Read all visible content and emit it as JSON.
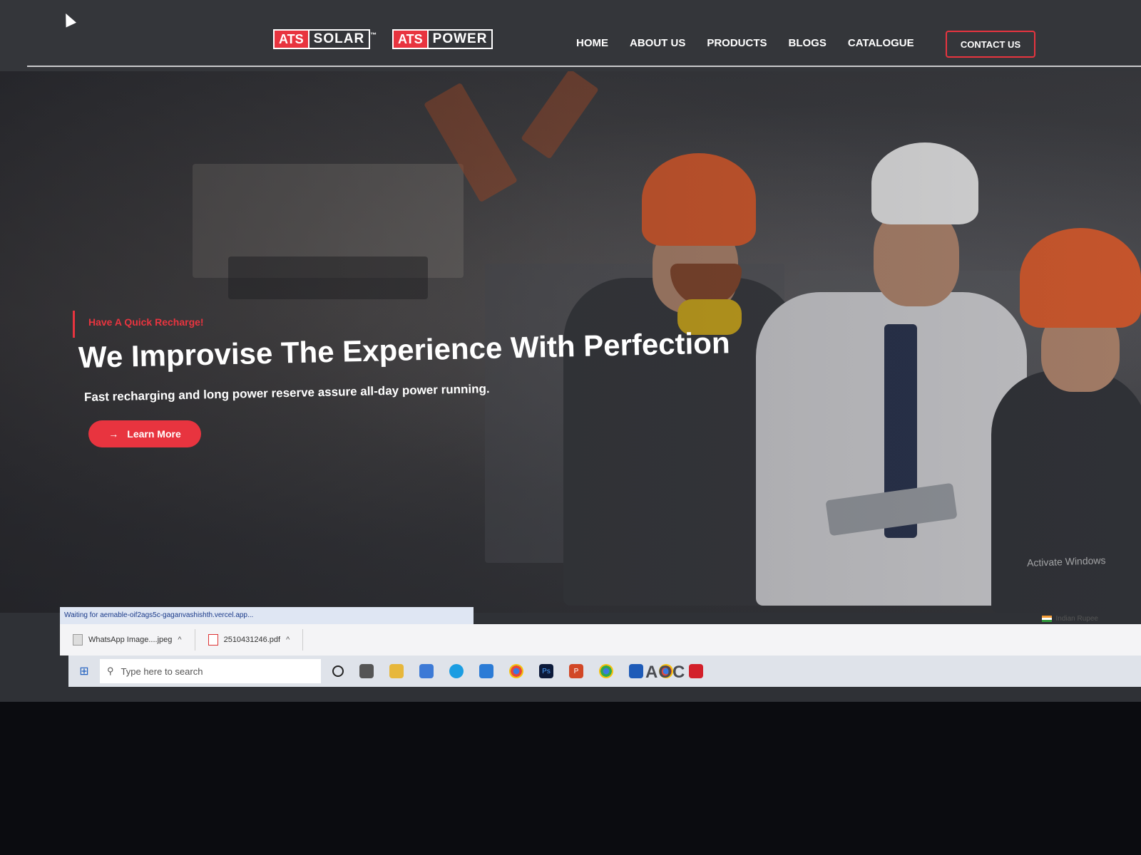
{
  "brand": {
    "logo1_tag": "ATS",
    "logo1_word": "SOLAR",
    "logo1_tm": "™",
    "logo2_tag": "ATS",
    "logo2_word": "POWER"
  },
  "nav": {
    "items": [
      "HOME",
      "ABOUT US",
      "PRODUCTS",
      "BLOGS",
      "CATALOGUE"
    ],
    "contact_label": "CONTACT US"
  },
  "hero": {
    "eyebrow": "Have A Quick Recharge!",
    "title": "We Improvise The Experience With Perfection",
    "subtitle": "Fast recharging and long power reserve assure all-day power running.",
    "cta_label": "Learn More",
    "watermark": "Activate Windows"
  },
  "browser": {
    "status_text": "Waiting for aemable-oif2ags5c-gaganvashishth.vercel.app...",
    "downloads": [
      {
        "name": "WhatsApp Image....jpeg"
      },
      {
        "name": "2510431246.pdf"
      }
    ],
    "language": "Indian Rupee"
  },
  "taskbar": {
    "search_placeholder": "Type here to search",
    "icons": [
      "cortana-icon",
      "task-view-icon",
      "file-explorer-icon",
      "store-icon",
      "edge-icon",
      "mail-icon",
      "chrome-icon",
      "photoshop-icon",
      "powerpoint-icon",
      "chrome-active-icon",
      "app-icon",
      "chrome-profile-icon",
      "acrobat-icon"
    ]
  },
  "monitor": {
    "brand": "AOC"
  },
  "colors": {
    "accent": "#e8343f",
    "header_bg": "#34363a",
    "text": "#ffffff"
  }
}
